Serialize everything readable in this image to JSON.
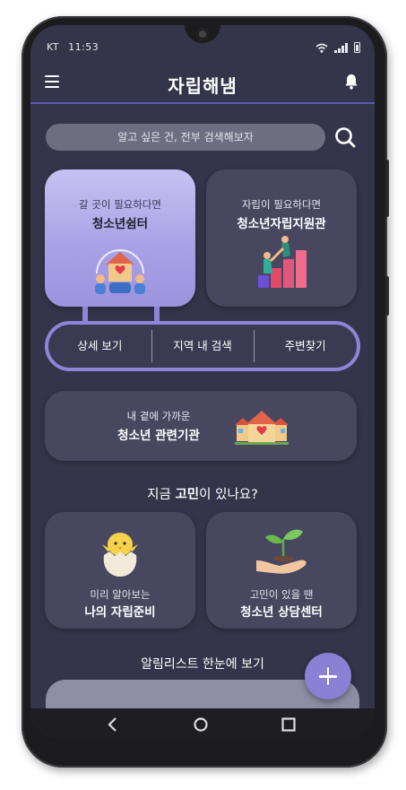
{
  "status": {
    "carrier": "KT",
    "time": "11:53",
    "icons": [
      "wifi-icon",
      "signal-icon",
      "battery-icon"
    ]
  },
  "header": {
    "title": "자립해냄",
    "menu_icon": "hamburger-icon",
    "notify_icon": "bell-icon"
  },
  "search": {
    "placeholder": "알고 싶은 건, 전부 검색해보자",
    "icon": "search-icon"
  },
  "cards": {
    "shelter": {
      "sub": "갈 곳이 필요하다면",
      "title": "청소년쉼터"
    },
    "support": {
      "sub": "자립이 필요하다면",
      "title": "청소년자립지원관"
    }
  },
  "actions": [
    "상세 보기",
    "지역 내 검색",
    "주변찾기"
  ],
  "nearby": {
    "sub": "내 곁에 가까운",
    "title": "청소년 관련기관"
  },
  "question": {
    "prefix": "지금 ",
    "bold": "고민",
    "suffix": "이 있나요?"
  },
  "worry_cards": {
    "ready": {
      "sub": "미리 알아보는",
      "title": "나의 자립준비"
    },
    "counsel": {
      "sub": "고민이 있을 땐",
      "title": "청소년 상담센터"
    }
  },
  "alarm": {
    "label": "알림리스트 한눈에 보기"
  },
  "colors": {
    "background": "#34344a",
    "card": "#474760",
    "accent": "#8d86d8",
    "highlight_card": "#b6b0ec"
  }
}
